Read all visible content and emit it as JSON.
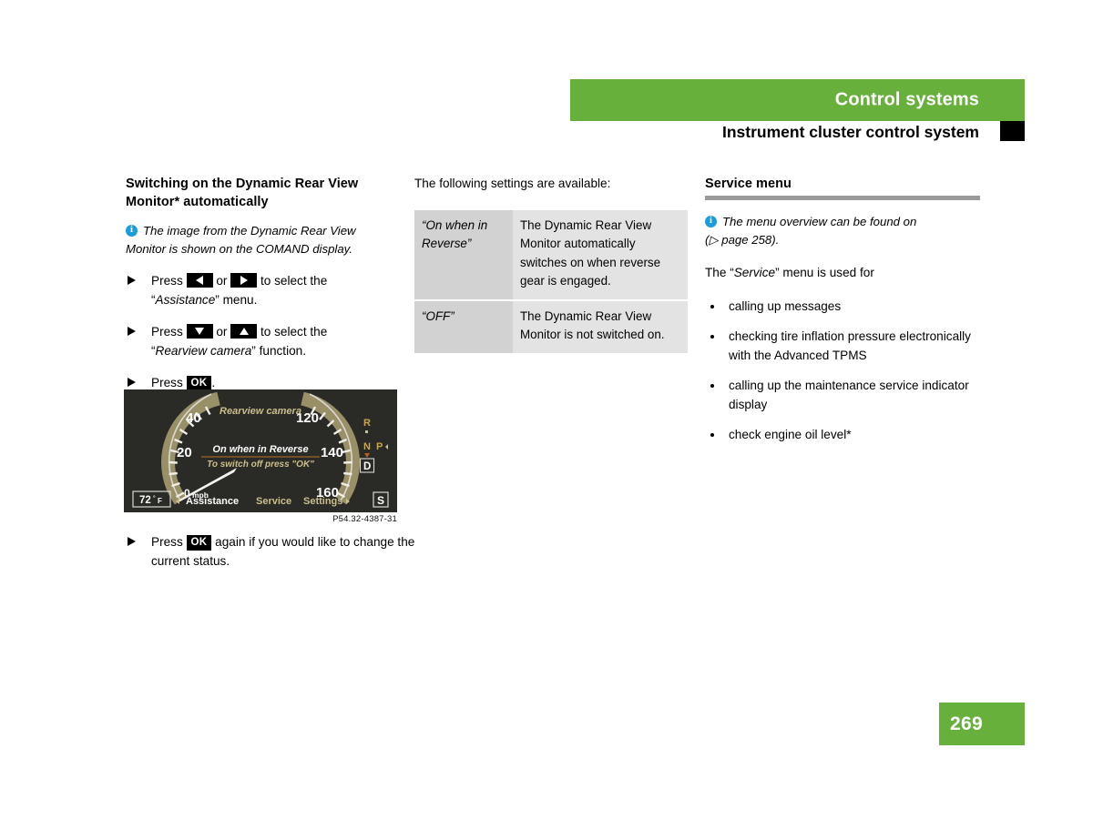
{
  "header": {
    "banner_title": "Control systems",
    "section_title": "Instrument cluster control system",
    "banner_color": "#68b03c"
  },
  "left_column": {
    "heading": "Switching on the Dynamic Rear View Monitor* automatically",
    "note": "The image from the Dynamic Rear View Monitor is shown on the COMAND display.",
    "steps": [
      {
        "press_label": "Press",
        "key_a": "left-arrow",
        "or_label": "or",
        "key_b": "right-arrow",
        "tail": "to select the",
        "line2_quote": "Assistance",
        "line2_tail": "menu."
      },
      {
        "press_label": "Press",
        "key_a": "down-arrow",
        "or_label": "or",
        "key_b": "up-arrow",
        "tail": "to select the",
        "line2_quote": "Rearview camera",
        "line2_tail": "function."
      },
      {
        "press_label": "Press",
        "key_ok": "OK",
        "tail": "."
      }
    ],
    "final_step": {
      "press_label": "Press",
      "key_ok": "OK",
      "tail": "again if you would like to change the current status."
    },
    "figure": {
      "caption": "P54.32-4387-31",
      "speed_ticks": [
        "20",
        "40",
        "120",
        "140",
        "160"
      ],
      "zero_label": "0",
      "unit_label": "mph",
      "title_text": "Rearview camera",
      "center_line1": "On when in Reverse",
      "center_line2": "To switch off press \"OK\"",
      "temperature": "72",
      "temperature_unit": "°F",
      "menu_items": [
        "Assistance",
        "Service",
        "Settings"
      ],
      "selected_menu": "Assistance",
      "gear_letters": [
        "R",
        "N",
        "P"
      ],
      "selected_gear": "D",
      "right_badge": "S",
      "dial_color": "#9a9068",
      "text_color": "#c9bf8c",
      "bg_color": "#2a2a26"
    }
  },
  "middle_column": {
    "intro": "The following settings are available:",
    "table": {
      "rows": [
        {
          "setting": "“On when in Reverse”",
          "description": "The Dynamic Rear View Monitor automatically switches on when reverse gear is engaged."
        },
        {
          "setting": "“OFF”",
          "description": "The Dynamic Rear View Monitor is not switched on."
        }
      ]
    }
  },
  "right_column": {
    "heading": "Service menu",
    "note_line1": "The menu overview can be found on",
    "note_line2_pre": "(",
    "note_line2_ref": "page 258",
    "note_line2_post": ").",
    "intro_pre": "The “",
    "intro_em": "Service",
    "intro_post": "” menu is used for",
    "bullets": [
      "calling up messages",
      "checking tire inflation pressure electronically with the Advanced TPMS",
      "calling up the maintenance service indicator display",
      "check engine oil level*"
    ]
  },
  "footer": {
    "page_number": "269",
    "badge_color": "#68b03c"
  }
}
